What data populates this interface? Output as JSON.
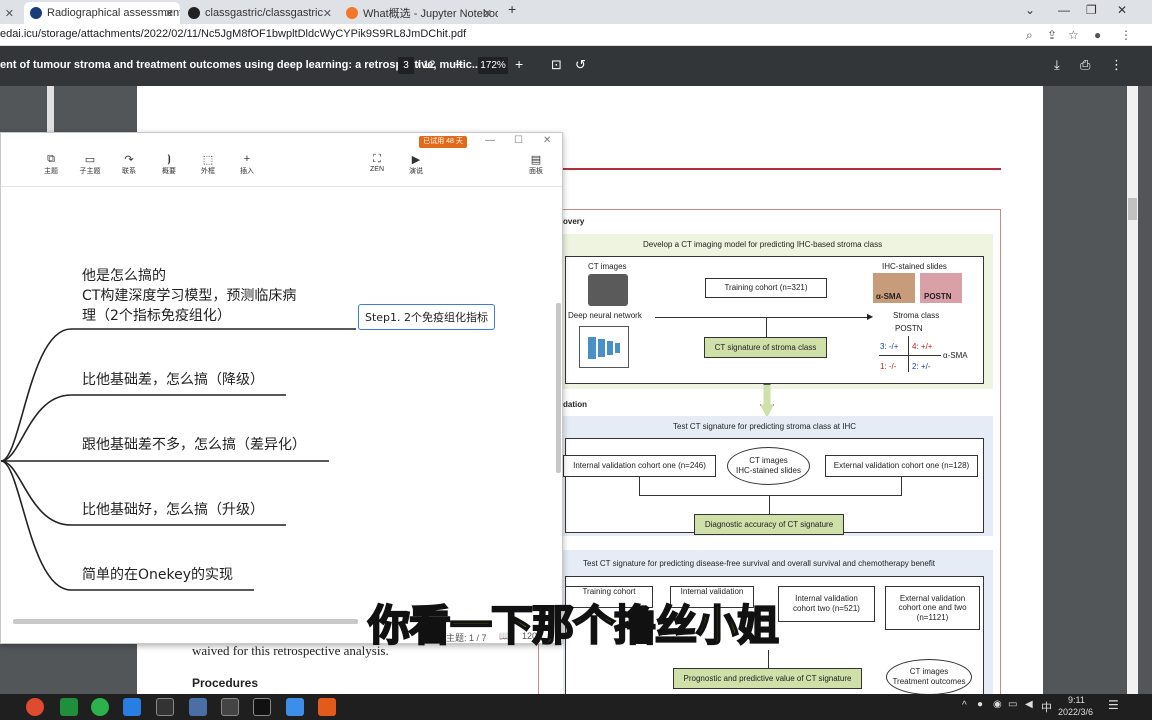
{
  "browser": {
    "tabs": [
      {
        "title": "Radiographical assessment of",
        "icon": "site-icon"
      },
      {
        "title": "classgastric/classgastric",
        "icon": "github-icon"
      },
      {
        "title": "What概选 - Jupyter Notebook",
        "icon": "jupyter-icon"
      }
    ],
    "url": "edai.icu/storage/attachments/2022/02/11/Nc5JgM8fOF1bwpltDldcWyCYPik9S9RL8JmDChit.pdf"
  },
  "pdf": {
    "title": "ent of tumour stroma and treatment outcomes using deep learning: a retrospective, multic...",
    "page_current": "3",
    "page_total": "/ 12",
    "zoom": "172%",
    "body_line": "waived for this retrospective analysis.",
    "heading": "Procedures",
    "figure": {
      "section1": "overy",
      "develop": "Develop a CT imaging model for predicting IHC-based stroma class",
      "ct_images": "CT images",
      "ihc_slides": "IHC-stained slides",
      "alpha_sma_tag": "α-SMA",
      "postn_tag": "POSTN",
      "deep_nn": "Deep neural network",
      "training_cohort": "Training cohort (n=321)",
      "ct_signature": "CT signature of stroma class",
      "stroma_class": "Stroma class",
      "postn_axis": "POSTN",
      "alpha_sma_axis": "α-SMA",
      "q3": "3: -/+",
      "q4": "4: +/+",
      "q1": "1: -/-",
      "q2": "2: +/-",
      "section2": "dation",
      "test_ihc": "Test CT signature for predicting stroma class at IHC",
      "internal1": "Internal validation cohort one (n=246)",
      "ct_ihc_bubble_1": "CT images",
      "ct_ihc_bubble_2": "IHC-stained slides",
      "external1": "External validation cohort one (n=128)",
      "diag_acc": "Diagnostic accuracy of CT signature",
      "test_dfs": "Test CT signature for predicting disease-free survival and overall survival and chemotherapy benefit",
      "tc2": "Training cohort",
      "iv_a": "Internal validation",
      "iv2_1": "Internal validation",
      "iv2_2": "cohort two (n=521)",
      "ev12_1": "External validation",
      "ev12_2": "cohort one and two",
      "ev12_3": "(n=1121)",
      "prog": "Prognostic and predictive value of CT signature",
      "ct_to_1": "CT images",
      "ct_to_2": "Treatment outcomes"
    }
  },
  "mindmap": {
    "trial_badge": "已试用 48 天",
    "toolbar": [
      {
        "label": "主题",
        "icon": "topic-icon"
      },
      {
        "label": "子主题",
        "icon": "subtopic-icon"
      },
      {
        "label": "联系",
        "icon": "relation-icon"
      },
      {
        "label": "概要",
        "icon": "summary-icon"
      },
      {
        "label": "外框",
        "icon": "boundary-icon"
      },
      {
        "label": "插入",
        "icon": "insert-icon"
      },
      {
        "label": "ZEN",
        "icon": "zen-icon"
      },
      {
        "label": "演说",
        "icon": "pitch-icon"
      },
      {
        "label": "面板",
        "icon": "panel-icon"
      }
    ],
    "nodes": [
      {
        "line1": "他是怎么搞的",
        "line2": "CT构建深度学习模型，预测临床病",
        "line3": "理（2个指标免疫组化）"
      },
      {
        "line1": "比他基础差，怎么搞（降级）"
      },
      {
        "line1": "跟他基础差不多，怎么搞（差异化）"
      },
      {
        "line1": "比他基础好，怎么搞（升级）"
      },
      {
        "line1": "简单的在Onekey的实现"
      }
    ],
    "step_label": "Step1. 2个免疫组化指标",
    "status_topics": "主题: 1 / 7",
    "status_zoom": "120"
  },
  "subtitle": "你看一下那个撸丝小姐",
  "taskbar": {
    "time": "9:11",
    "date": "2022/3/6",
    "ime": "中"
  }
}
